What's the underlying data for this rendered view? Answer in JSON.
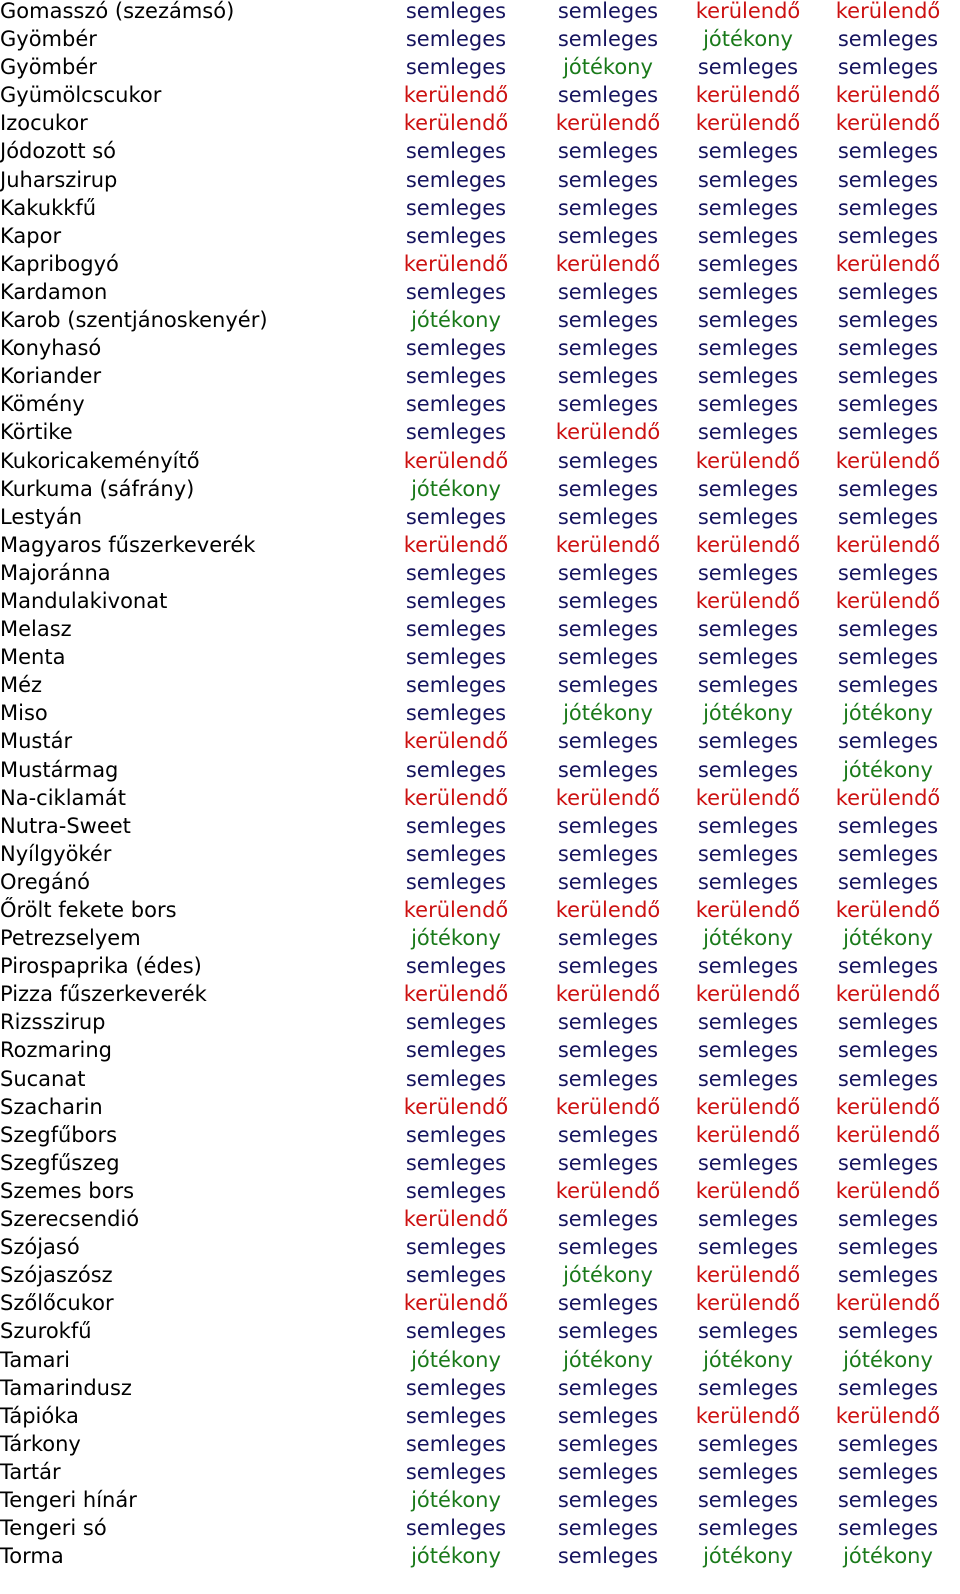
{
  "colors": {
    "semleges": "#16145e",
    "kerülendő": "#cc1111",
    "jótékony": "#1a7a1a",
    "name": "#000000"
  },
  "rows": [
    {
      "name": "Gomasszó (szezámsó)",
      "values": [
        "semleges",
        "semleges",
        "kerülendő",
        "kerülendő"
      ]
    },
    {
      "name": "Gyömbér",
      "values": [
        "semleges",
        "semleges",
        "jótékony",
        "semleges"
      ]
    },
    {
      "name": "Gyömbér",
      "values": [
        "semleges",
        "jótékony",
        "semleges",
        "semleges"
      ]
    },
    {
      "name": "Gyümölcscukor",
      "values": [
        "kerülendő",
        "semleges",
        "kerülendő",
        "kerülendő"
      ]
    },
    {
      "name": "Izocukor",
      "values": [
        "kerülendő",
        "kerülendő",
        "kerülendő",
        "kerülendő"
      ]
    },
    {
      "name": "Jódozott só",
      "values": [
        "semleges",
        "semleges",
        "semleges",
        "semleges"
      ]
    },
    {
      "name": "Juharszirup",
      "values": [
        "semleges",
        "semleges",
        "semleges",
        "semleges"
      ]
    },
    {
      "name": "Kakukkfű",
      "values": [
        "semleges",
        "semleges",
        "semleges",
        "semleges"
      ]
    },
    {
      "name": "Kapor",
      "values": [
        "semleges",
        "semleges",
        "semleges",
        "semleges"
      ]
    },
    {
      "name": "Kapribogyó",
      "values": [
        "kerülendő",
        "kerülendő",
        "semleges",
        "kerülendő"
      ]
    },
    {
      "name": "Kardamon",
      "values": [
        "semleges",
        "semleges",
        "semleges",
        "semleges"
      ]
    },
    {
      "name": "Karob (szentjánoskenyér)",
      "values": [
        "jótékony",
        "semleges",
        "semleges",
        "semleges"
      ]
    },
    {
      "name": "Konyhasó",
      "values": [
        "semleges",
        "semleges",
        "semleges",
        "semleges"
      ]
    },
    {
      "name": "Koriander",
      "values": [
        "semleges",
        "semleges",
        "semleges",
        "semleges"
      ]
    },
    {
      "name": "Kömény",
      "values": [
        "semleges",
        "semleges",
        "semleges",
        "semleges"
      ]
    },
    {
      "name": "Körtike",
      "values": [
        "semleges",
        "kerülendő",
        "semleges",
        "semleges"
      ]
    },
    {
      "name": "Kukoricakeményítő",
      "values": [
        "kerülendő",
        "semleges",
        "kerülendő",
        "kerülendő"
      ]
    },
    {
      "name": "Kurkuma (sáfrány)",
      "values": [
        "jótékony",
        "semleges",
        "semleges",
        "semleges"
      ]
    },
    {
      "name": "Lestyán",
      "values": [
        "semleges",
        "semleges",
        "semleges",
        "semleges"
      ]
    },
    {
      "name": "Magyaros fűszerkeverék",
      "values": [
        "kerülendő",
        "kerülendő",
        "kerülendő",
        "kerülendő"
      ]
    },
    {
      "name": "Majoránna",
      "values": [
        "semleges",
        "semleges",
        "semleges",
        "semleges"
      ]
    },
    {
      "name": "Mandulakivonat",
      "values": [
        "semleges",
        "semleges",
        "kerülendő",
        "kerülendő"
      ]
    },
    {
      "name": "Melasz",
      "values": [
        "semleges",
        "semleges",
        "semleges",
        "semleges"
      ]
    },
    {
      "name": "Menta",
      "values": [
        "semleges",
        "semleges",
        "semleges",
        "semleges"
      ]
    },
    {
      "name": "Méz",
      "values": [
        "semleges",
        "semleges",
        "semleges",
        "semleges"
      ]
    },
    {
      "name": "Miso",
      "values": [
        "semleges",
        "jótékony",
        "jótékony",
        "jótékony"
      ]
    },
    {
      "name": "Mustár",
      "values": [
        "kerülendő",
        "semleges",
        "semleges",
        "semleges"
      ]
    },
    {
      "name": "Mustármag",
      "values": [
        "semleges",
        "semleges",
        "semleges",
        "jótékony"
      ]
    },
    {
      "name": "Na-ciklamát",
      "values": [
        "kerülendő",
        "kerülendő",
        "kerülendő",
        "kerülendő"
      ]
    },
    {
      "name": "Nutra-Sweet",
      "values": [
        "semleges",
        "semleges",
        "semleges",
        "semleges"
      ]
    },
    {
      "name": "Nyílgyökér",
      "values": [
        "semleges",
        "semleges",
        "semleges",
        "semleges"
      ]
    },
    {
      "name": "Oregánó",
      "values": [
        "semleges",
        "semleges",
        "semleges",
        "semleges"
      ]
    },
    {
      "name": "Őrölt fekete bors",
      "values": [
        "kerülendő",
        "kerülendő",
        "kerülendő",
        "kerülendő"
      ]
    },
    {
      "name": "Petrezselyem",
      "values": [
        "jótékony",
        "semleges",
        "jótékony",
        "jótékony"
      ]
    },
    {
      "name": "Pirospaprika (édes)",
      "values": [
        "semleges",
        "semleges",
        "semleges",
        "semleges"
      ]
    },
    {
      "name": "Pizza fűszerkeverék",
      "values": [
        "kerülendő",
        "kerülendő",
        "kerülendő",
        "kerülendő"
      ]
    },
    {
      "name": "Rizsszirup",
      "values": [
        "semleges",
        "semleges",
        "semleges",
        "semleges"
      ]
    },
    {
      "name": "Rozmaring",
      "values": [
        "semleges",
        "semleges",
        "semleges",
        "semleges"
      ]
    },
    {
      "name": "Sucanat",
      "values": [
        "semleges",
        "semleges",
        "semleges",
        "semleges"
      ]
    },
    {
      "name": "Szacharin",
      "values": [
        "kerülendő",
        "kerülendő",
        "kerülendő",
        "kerülendő"
      ]
    },
    {
      "name": "Szegfűbors",
      "values": [
        "semleges",
        "semleges",
        "kerülendő",
        "kerülendő"
      ]
    },
    {
      "name": "Szegfűszeg",
      "values": [
        "semleges",
        "semleges",
        "semleges",
        "semleges"
      ]
    },
    {
      "name": "Szemes bors",
      "values": [
        "semleges",
        "kerülendő",
        "kerülendő",
        "kerülendő"
      ]
    },
    {
      "name": "Szerecsendió",
      "values": [
        "kerülendő",
        "semleges",
        "semleges",
        "semleges"
      ]
    },
    {
      "name": "Szójasó",
      "values": [
        "semleges",
        "semleges",
        "semleges",
        "semleges"
      ]
    },
    {
      "name": "Szójaszósz",
      "values": [
        "semleges",
        "jótékony",
        "kerülendő",
        "semleges"
      ]
    },
    {
      "name": "Szőlőcukor",
      "values": [
        "kerülendő",
        "semleges",
        "kerülendő",
        "kerülendő"
      ]
    },
    {
      "name": "Szurokfű",
      "values": [
        "semleges",
        "semleges",
        "semleges",
        "semleges"
      ]
    },
    {
      "name": "Tamari",
      "values": [
        "jótékony",
        "jótékony",
        "jótékony",
        "jótékony"
      ]
    },
    {
      "name": "Tamarindusz",
      "values": [
        "semleges",
        "semleges",
        "semleges",
        "semleges"
      ]
    },
    {
      "name": "Tápióka",
      "values": [
        "semleges",
        "semleges",
        "kerülendő",
        "kerülendő"
      ]
    },
    {
      "name": "Tárkony",
      "values": [
        "semleges",
        "semleges",
        "semleges",
        "semleges"
      ]
    },
    {
      "name": "Tartár",
      "values": [
        "semleges",
        "semleges",
        "semleges",
        "semleges"
      ]
    },
    {
      "name": "Tengeri hínár",
      "values": [
        "jótékony",
        "semleges",
        "semleges",
        "semleges"
      ]
    },
    {
      "name": "Tengeri só",
      "values": [
        "semleges",
        "semleges",
        "semleges",
        "semleges"
      ]
    },
    {
      "name": "Torma",
      "values": [
        "jótékony",
        "semleges",
        "jótékony",
        "jótékony"
      ]
    }
  ]
}
